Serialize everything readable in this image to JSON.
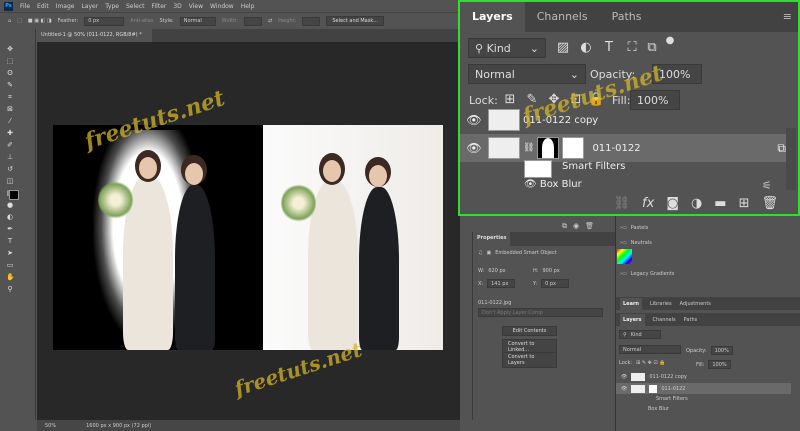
{
  "menu": {
    "logo": "Ps",
    "items": [
      "File",
      "Edit",
      "Image",
      "Layer",
      "Type",
      "Select",
      "Filter",
      "3D",
      "View",
      "Window",
      "Help"
    ]
  },
  "options": {
    "feather_label": "Feather:",
    "feather_value": "0 px",
    "antialias": "Anti-alias",
    "style_label": "Style:",
    "style_value": "Normal",
    "width_label": "Width:",
    "height_label": "Height:",
    "select_mask": "Select and Mask..."
  },
  "document": {
    "tab_title": "Untitled-1 @ 50% (011-0122, RGB/8#) *",
    "zoom": "50%",
    "size": "1600 px x 900 px (72 ppi)"
  },
  "watermark": "freetuts.net",
  "big_layers": {
    "tabs": [
      "Layers",
      "Channels",
      "Paths"
    ],
    "kind": "Kind",
    "blend": "Normal",
    "opacity_label": "Opacity:",
    "opacity": "100%",
    "lock_label": "Lock:",
    "fill_label": "Fill:",
    "fill": "100%",
    "layers": [
      {
        "name": "011-0122 copy"
      },
      {
        "name": "011-0122"
      }
    ],
    "smart_filters": "Smart Filters",
    "filter": "Box Blur"
  },
  "properties": {
    "title": "Properties",
    "type": "Embedded Smart Object",
    "w_label": "W:",
    "w": "620 px",
    "h_label": "H:",
    "h": "900 px",
    "x_label": "X:",
    "x": "141 px",
    "y_label": "Y:",
    "y": "0 px",
    "file": "011-0122.jpg",
    "layer_comp": "Don't Apply Layer Comp",
    "buttons": [
      "Edit Contents",
      "Convert to Linked...",
      "Convert to Layers"
    ]
  },
  "gradients": {
    "folders": [
      "Pastels",
      "Neutrals",
      "Legacy Gradients"
    ]
  },
  "small_panels": {
    "tabs1": [
      "Learn",
      "Libraries",
      "Adjustments"
    ],
    "tabs2": [
      "Layers",
      "Channels",
      "Paths"
    ],
    "kind": "Kind",
    "blend": "Normal",
    "opacity_label": "Opacity:",
    "opacity": "100%",
    "lock_label": "Lock:",
    "fill_label": "Fill:",
    "fill": "100%",
    "layers": [
      "011-0122 copy",
      "011-0122"
    ],
    "smart_filters": "Smart Filters",
    "filter": "Box Blur"
  },
  "colors": {
    "highlight": "#2ee02e",
    "bg": "#535353",
    "canvas": "#282828"
  }
}
